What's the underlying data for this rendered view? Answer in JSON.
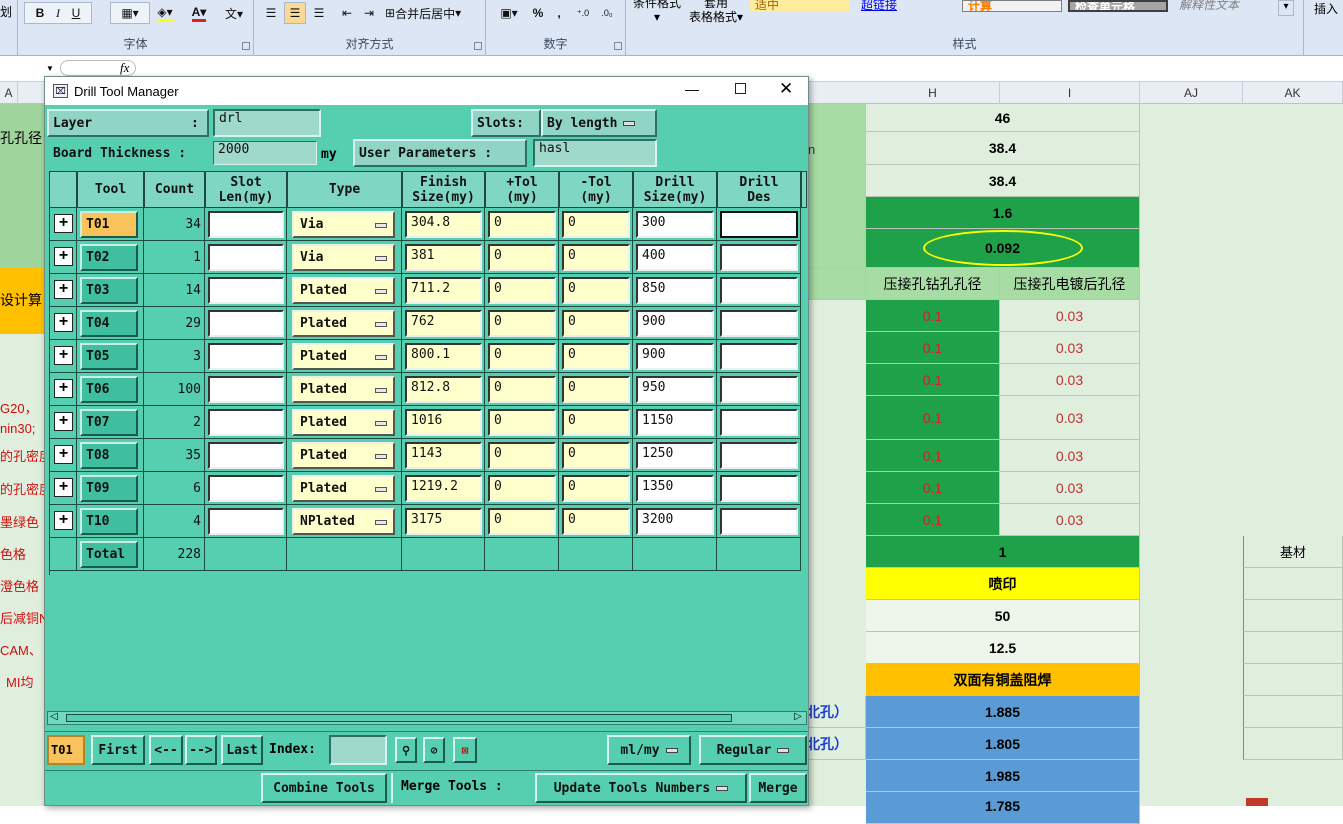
{
  "ribbon": {
    "groups": {
      "font": "字体",
      "align": "对齐方式",
      "number": "数字",
      "styles": "样式"
    },
    "font_buttons": [
      "B",
      "I",
      "U"
    ],
    "align_merge": "合并后居中",
    "number_buttons": [
      "%",
      ","
    ],
    "cond_format": "条件格式",
    "table_format_1": "套用",
    "table_format_2": "表格格式",
    "style_cells": [
      "适中",
      "超链接",
      "计算",
      "检查单元格",
      "解释性文本"
    ],
    "insert": "插入"
  },
  "formula_bar": {
    "fx": "fx"
  },
  "columns": {
    "a": "A",
    "h": "H",
    "i": "I",
    "aj": "AJ",
    "ak": "AK"
  },
  "sheet": {
    "left_texts": [
      "孔孔径",
      "设计算",
      "G20，",
      "nin30;",
      "的孔密度",
      "的孔密度",
      "墨绿色",
      "色格",
      "澄色格",
      "后减铜N",
      "CAM、",
      "MI均",
      "划"
    ],
    "blue_partial": [
      "北孔）",
      "北孔）",
      "n"
    ],
    "h_values": [
      "46",
      "38.4",
      "38.4",
      "1.6",
      "0.092"
    ],
    "h_header": "压接孔钻孔孔径",
    "i_header": "压接孔电镀后孔径",
    "h_red": [
      "0.1",
      "0.1",
      "0.1",
      "0.1",
      "0.1",
      "0.1",
      "0.1"
    ],
    "i_red": [
      "0.03",
      "0.03",
      "0.03",
      "0.03",
      "0.03",
      "0.03",
      "0.03"
    ],
    "h_lower": [
      "1",
      "喷印",
      "50",
      "12.5",
      "双面有铜盖阻焊",
      "1.885",
      "1.805",
      "1.985",
      "1.785"
    ],
    "ak_label": "基材"
  },
  "dialog": {
    "title": "Drill Tool Manager",
    "layer_label": "Layer",
    "layer_colon": ":",
    "layer_value": "drl",
    "slots_label": "Slots:",
    "slots_value": "By length",
    "thickness_label": "Board Thickness :",
    "thickness_value": "2000",
    "thickness_unit": "my",
    "user_params_label": "User Parameters :",
    "user_params_value": "hasl",
    "headers": {
      "tool": "Tool",
      "count": "Count",
      "slot1": "Slot",
      "slot2": "Len(my)",
      "type": "Type",
      "finish1": "Finish",
      "finish2": "Size(my)",
      "ptol1": "+Tol",
      "ptol2": "(my)",
      "ntol1": "-Tol",
      "ntol2": "(my)",
      "drill1": "Drill",
      "drill2": "Size(my)",
      "des1": "Drill",
      "des2": "Des"
    },
    "rows": [
      {
        "plus": "+",
        "tool": "T01",
        "count": "34",
        "type": "Via",
        "finish": "304.8",
        "ptol": "0",
        "ntol": "0",
        "drill": "300"
      },
      {
        "plus": "+",
        "tool": "T02",
        "count": "1",
        "type": "Via",
        "finish": "381",
        "ptol": "0",
        "ntol": "0",
        "drill": "400"
      },
      {
        "plus": "+",
        "tool": "T03",
        "count": "14",
        "type": "Plated",
        "finish": "711.2",
        "ptol": "0",
        "ntol": "0",
        "drill": "850"
      },
      {
        "plus": "+",
        "tool": "T04",
        "count": "29",
        "type": "Plated",
        "finish": "762",
        "ptol": "0",
        "ntol": "0",
        "drill": "900"
      },
      {
        "plus": "+",
        "tool": "T05",
        "count": "3",
        "type": "Plated",
        "finish": "800.1",
        "ptol": "0",
        "ntol": "0",
        "drill": "900"
      },
      {
        "plus": "+",
        "tool": "T06",
        "count": "100",
        "type": "Plated",
        "finish": "812.8",
        "ptol": "0",
        "ntol": "0",
        "drill": "950"
      },
      {
        "plus": "+",
        "tool": "T07",
        "count": "2",
        "type": "Plated",
        "finish": "1016",
        "ptol": "0",
        "ntol": "0",
        "drill": "1150"
      },
      {
        "plus": "+",
        "tool": "T08",
        "count": "35",
        "type": "Plated",
        "finish": "1143",
        "ptol": "0",
        "ntol": "0",
        "drill": "1250"
      },
      {
        "plus": "+",
        "tool": "T09",
        "count": "6",
        "type": "Plated",
        "finish": "1219.2",
        "ptol": "0",
        "ntol": "0",
        "drill": "1350"
      },
      {
        "plus": "+",
        "tool": "T10",
        "count": "4",
        "type": "NPlated",
        "finish": "3175",
        "ptol": "0",
        "ntol": "0",
        "drill": "3200"
      }
    ],
    "total_label": "Total",
    "total_count": "228",
    "nav": {
      "current": "T01",
      "first": "First",
      "prev": "<--",
      "next": "-->",
      "last": "Last",
      "index_label": "Index:",
      "units": "ml/my",
      "mode": "Regular"
    },
    "bottom": {
      "combine": "Combine Tools",
      "merge_label": "Merge Tools :",
      "update": "Update Tools Numbers",
      "merge": "Merge"
    }
  },
  "colors": {
    "teal": "#55cfb0",
    "green_cell": "#1fa14a",
    "yellow": "#ffff00",
    "orange": "#ffc000",
    "blue": "#5b9bd5"
  }
}
